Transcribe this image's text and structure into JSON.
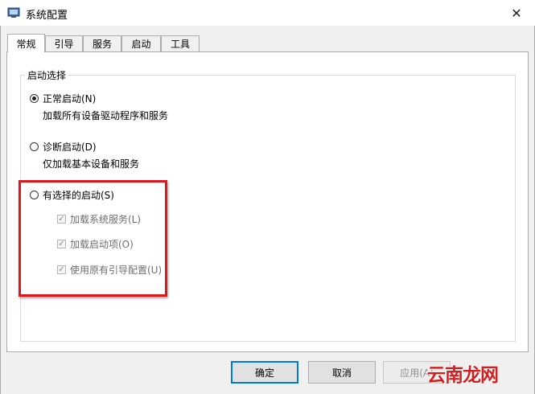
{
  "window": {
    "title": "系统配置"
  },
  "tabs": [
    {
      "label": "常规",
      "active": true
    },
    {
      "label": "引导"
    },
    {
      "label": "服务"
    },
    {
      "label": "启动"
    },
    {
      "label": "工具"
    }
  ],
  "startup_selection": {
    "title": "启动选择",
    "normal": {
      "label": "正常启动(N)",
      "description": "加载所有设备驱动程序和服务",
      "checked": true
    },
    "diagnostic": {
      "label": "诊断启动(D)",
      "description": "仅加载基本设备和服务",
      "checked": false
    },
    "selective": {
      "label": "有选择的启动(S)",
      "checked": false,
      "options": [
        {
          "label": "加载系统服务(L)",
          "checked": true
        },
        {
          "label": "加载启动项(O)",
          "checked": true
        },
        {
          "label": "使用原有引导配置(U)",
          "checked": true
        }
      ]
    }
  },
  "buttons": {
    "ok": "确定",
    "cancel": "取消",
    "apply": "应用(A)"
  },
  "watermark": "云南龙网",
  "colors": {
    "highlight": "#e0161d",
    "accent": "#0078d7"
  }
}
